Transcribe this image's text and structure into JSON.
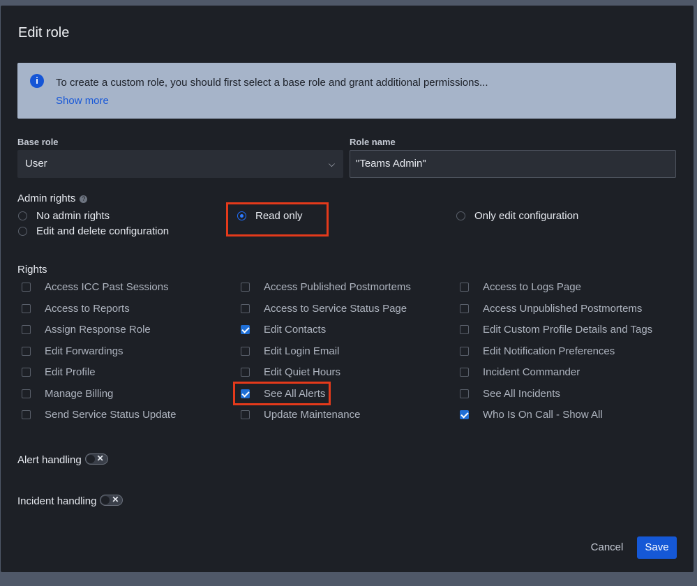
{
  "dialog": {
    "title": "Edit role"
  },
  "info": {
    "text": "To create a custom role, you should first select a base role and grant additional permissions...",
    "link": "Show more"
  },
  "base_role": {
    "label": "Base role",
    "value": "User"
  },
  "role_name": {
    "label": "Role name",
    "value": "\"Teams Admin\""
  },
  "admin_rights": {
    "label": "Admin rights",
    "options": [
      {
        "label": "No admin rights",
        "selected": false
      },
      {
        "label": "Read only",
        "selected": true
      },
      {
        "label": "Only edit configuration",
        "selected": false
      },
      {
        "label": "Edit and delete configuration",
        "selected": false
      }
    ]
  },
  "rights": {
    "label": "Rights",
    "items": [
      {
        "label": "Access ICC Past Sessions",
        "checked": false
      },
      {
        "label": "Access Published Postmortems",
        "checked": false
      },
      {
        "label": "Access to Logs Page",
        "checked": false
      },
      {
        "label": "Access to Reports",
        "checked": false
      },
      {
        "label": "Access to Service Status Page",
        "checked": false
      },
      {
        "label": "Access Unpublished Postmortems",
        "checked": false
      },
      {
        "label": "Assign Response Role",
        "checked": false
      },
      {
        "label": "Edit Contacts",
        "checked": true
      },
      {
        "label": "Edit Custom Profile Details and Tags",
        "checked": false
      },
      {
        "label": "Edit Forwardings",
        "checked": false
      },
      {
        "label": "Edit Login Email",
        "checked": false
      },
      {
        "label": "Edit Notification Preferences",
        "checked": false
      },
      {
        "label": "Edit Profile",
        "checked": false
      },
      {
        "label": "Edit Quiet Hours",
        "checked": false
      },
      {
        "label": "Incident Commander",
        "checked": false
      },
      {
        "label": "Manage Billing",
        "checked": false
      },
      {
        "label": "See All Alerts",
        "checked": true
      },
      {
        "label": "See All Incidents",
        "checked": false
      },
      {
        "label": "Send Service Status Update",
        "checked": false
      },
      {
        "label": "Update Maintenance",
        "checked": false
      },
      {
        "label": "Who Is On Call - Show All",
        "checked": true
      }
    ]
  },
  "alert_handling": {
    "label": "Alert handling",
    "enabled": false
  },
  "incident_handling": {
    "label": "Incident handling",
    "enabled": false
  },
  "actions": {
    "cancel": "Cancel",
    "save": "Save"
  },
  "colors": {
    "accent": "#1558d6",
    "highlight": "#e43a1b",
    "modal_bg": "#1d2026"
  }
}
